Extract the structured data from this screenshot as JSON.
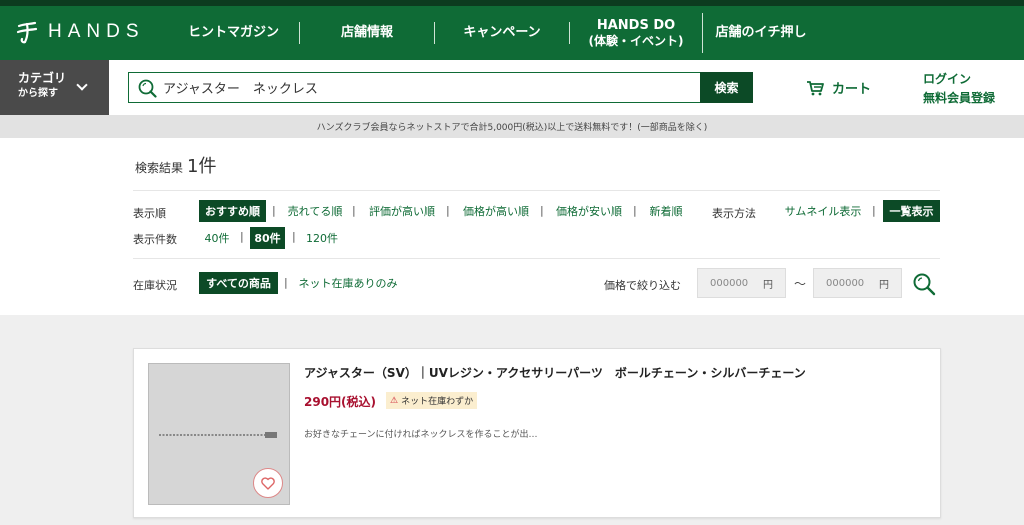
{
  "header": {
    "logo_text": "HANDS",
    "nav": [
      {
        "label": "ヒントマガジン",
        "sub": ""
      },
      {
        "label": "店舗情報",
        "sub": ""
      },
      {
        "label": "キャンペーン",
        "sub": ""
      },
      {
        "label": "HANDS DO",
        "sub": "(体験・イベント)"
      },
      {
        "label": "店舗のイチ押し",
        "sub": ""
      }
    ]
  },
  "search": {
    "category_line1": "カテゴリ",
    "category_line2": "から探す",
    "value": "アジャスター　ネックレス",
    "button_label": "検索"
  },
  "account": {
    "cart_label": "カート",
    "login_label": "ログイン",
    "register_label": "無料会員登録"
  },
  "notice": "ハンズクラブ会員ならネットストアで合計5,000円(税込)以上で送料無料です！(一部商品を除く)",
  "results": {
    "label": "検索結果",
    "count": "1件"
  },
  "sort": {
    "label": "表示順",
    "options": [
      "おすすめ順",
      "売れてる順",
      "評価が高い順",
      "価格が高い順",
      "価格が安い順",
      "新着順"
    ],
    "selected": "おすすめ順"
  },
  "display": {
    "label": "表示方法",
    "options": [
      "サムネイル表示",
      "一覧表示"
    ],
    "selected": "一覧表示"
  },
  "per_page": {
    "label": "表示件数",
    "options": [
      "40件",
      "80件",
      "120件"
    ],
    "selected": "80件"
  },
  "stock": {
    "label": "在庫状況",
    "options": [
      "すべての商品",
      "ネット在庫ありのみ"
    ],
    "selected": "すべての商品"
  },
  "price_filter": {
    "label": "価格で絞り込む",
    "min_placeholder": "000000",
    "max_placeholder": "000000",
    "unit": "円",
    "tilde": "〜"
  },
  "products": [
    {
      "title": "アジャスター（SV）｜UVレジン・アクセサリーパーツ　ボールチェーン・シルバーチェーン",
      "price": "290円(税込)",
      "stock_icon": "⚠",
      "stock_text": "ネット在庫わずか",
      "description": "お好きなチェーンに付ければネックレスを作ることが出…"
    }
  ],
  "colors": {
    "brand_green": "#0f6b36",
    "dark_green": "#0c4a26",
    "price_red": "#a8102f"
  }
}
